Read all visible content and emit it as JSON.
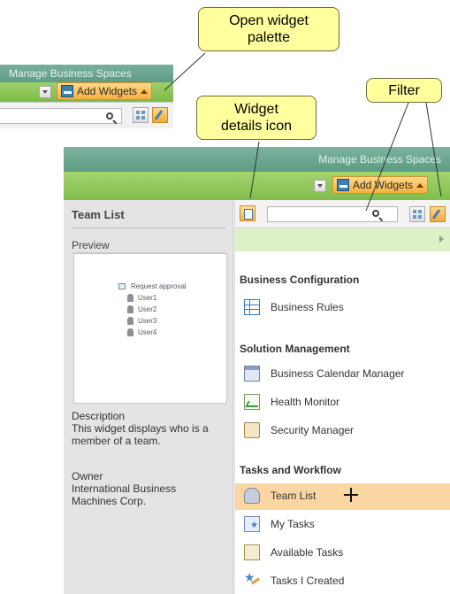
{
  "callouts": {
    "open_palette": "Open widget\npalette",
    "details_icon": "Widget\ndetails icon",
    "filter": "Filter"
  },
  "snippet": {
    "banner": "Manage Business Spaces",
    "add_widgets": "Add Widgets"
  },
  "main": {
    "banner": "Manage Business Spaces",
    "add_widgets": "Add Widgets"
  },
  "details": {
    "title": "Team List",
    "preview_label": "Preview",
    "preview_tree": {
      "root": "Request approval",
      "children": [
        "User1",
        "User2",
        "User3",
        "User4"
      ]
    },
    "description_heading": "Description",
    "description": "This widget displays who is a member of a team.",
    "owner_heading": "Owner",
    "owner": "International Business Machines Corp."
  },
  "palette": {
    "search_placeholder": "",
    "categories": [
      {
        "heading": "Business Configuration",
        "items": [
          {
            "label": "Business Rules",
            "icon": "table-icon"
          }
        ]
      },
      {
        "heading": "Solution Management",
        "items": [
          {
            "label": "Business Calendar Manager",
            "icon": "calendar-icon"
          },
          {
            "label": "Health Monitor",
            "icon": "health-monitor-icon"
          },
          {
            "label": "Security Manager",
            "icon": "security-icon"
          }
        ]
      },
      {
        "heading": "Tasks and Workflow",
        "items": [
          {
            "label": "Team List",
            "icon": "team-icon",
            "selected": true
          },
          {
            "label": "My Tasks",
            "icon": "my-tasks-icon"
          },
          {
            "label": "Available Tasks",
            "icon": "available-tasks-icon"
          },
          {
            "label": "Tasks I Created",
            "icon": "tasks-created-icon"
          }
        ]
      }
    ]
  },
  "colors": {
    "callout_fill": "#ffff9e",
    "banner": "#6aa690",
    "toolbar_green": "#8cc55a",
    "selected_row": "#fad6a3",
    "add_button": "#f5b13f"
  }
}
